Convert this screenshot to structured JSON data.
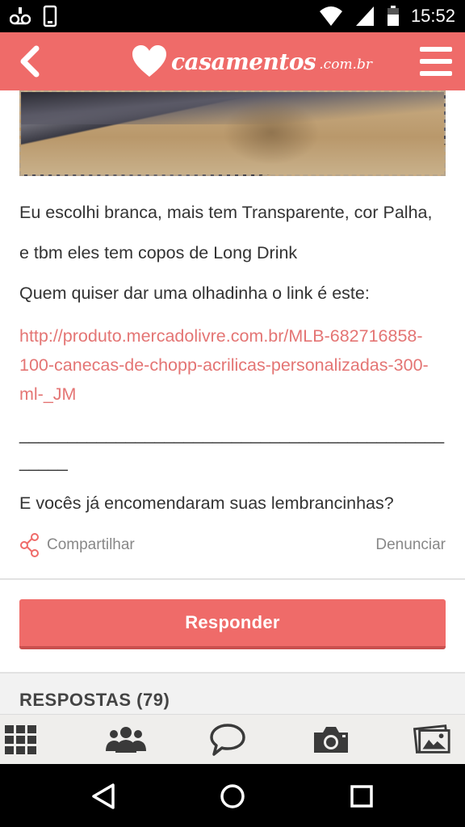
{
  "status_bar": {
    "time": "15:52",
    "icons": [
      "voicemail-icon",
      "phone-icon",
      "wifi-icon",
      "signal-icon",
      "battery-icon"
    ]
  },
  "app_bar": {
    "logo_text": "casamentos",
    "logo_domain": ".com.br",
    "icons": [
      "back-arrow-icon",
      "heart-logo-icon",
      "hamburger-menu-icon"
    ]
  },
  "post": {
    "paragraphs": [
      "Eu escolhi branca, mais tem Transparente, cor Palha,",
      "e tbm eles tem copos de Long Drink",
      "Quem quiser dar uma olhadinha o link é este:"
    ],
    "link_text": "http://produto.mercadolivre.com.br/MLB-682716858-100-canecas-de-chopp-acrilicas-personalizadas-300-ml-_JM",
    "separator_line1": "____________________________________________",
    "separator_line2": "_____",
    "question": "E vocês já encomendaram suas lembrancinhas?"
  },
  "actions": {
    "share_label": "Compartilhar",
    "report_label": "Denunciar"
  },
  "reply": {
    "button_label": "Responder"
  },
  "responses": {
    "title": "RESPOSTAS (79)"
  },
  "tab_bar": {
    "items": [
      "grid-icon",
      "community-icon",
      "chat-icon",
      "camera-icon",
      "photos-icon"
    ]
  },
  "nav_bar": {
    "items": [
      "back-triangle-icon",
      "home-circle-icon",
      "recents-square-icon"
    ]
  },
  "colors": {
    "accent": "#ef6b69",
    "link": "#e47574",
    "text": "#333333",
    "muted": "#888888"
  }
}
